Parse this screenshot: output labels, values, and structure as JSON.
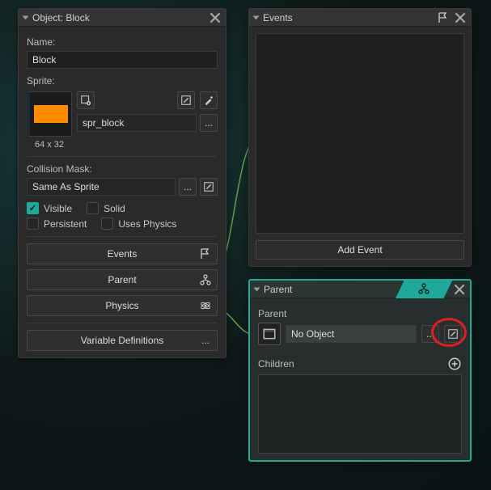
{
  "object_panel": {
    "title": "Object: Block",
    "name_label": "Name:",
    "name_value": "Block",
    "sprite_label": "Sprite:",
    "sprite_name": "spr_block",
    "sprite_dims": "64 x 32",
    "sprite_color": "#ff8a00",
    "collision_label": "Collision Mask:",
    "collision_value": "Same As Sprite",
    "checks": {
      "visible": "Visible",
      "solid": "Solid",
      "persistent": "Persistent",
      "uses_physics": "Uses Physics"
    },
    "buttons": {
      "events": "Events",
      "parent": "Parent",
      "physics": "Physics",
      "vardefs": "Variable Definitions"
    }
  },
  "events_panel": {
    "title": "Events",
    "add_event": "Add Event"
  },
  "parent_panel": {
    "title": "Parent",
    "parent_label": "Parent",
    "parent_value": "No Object",
    "children_label": "Children"
  }
}
